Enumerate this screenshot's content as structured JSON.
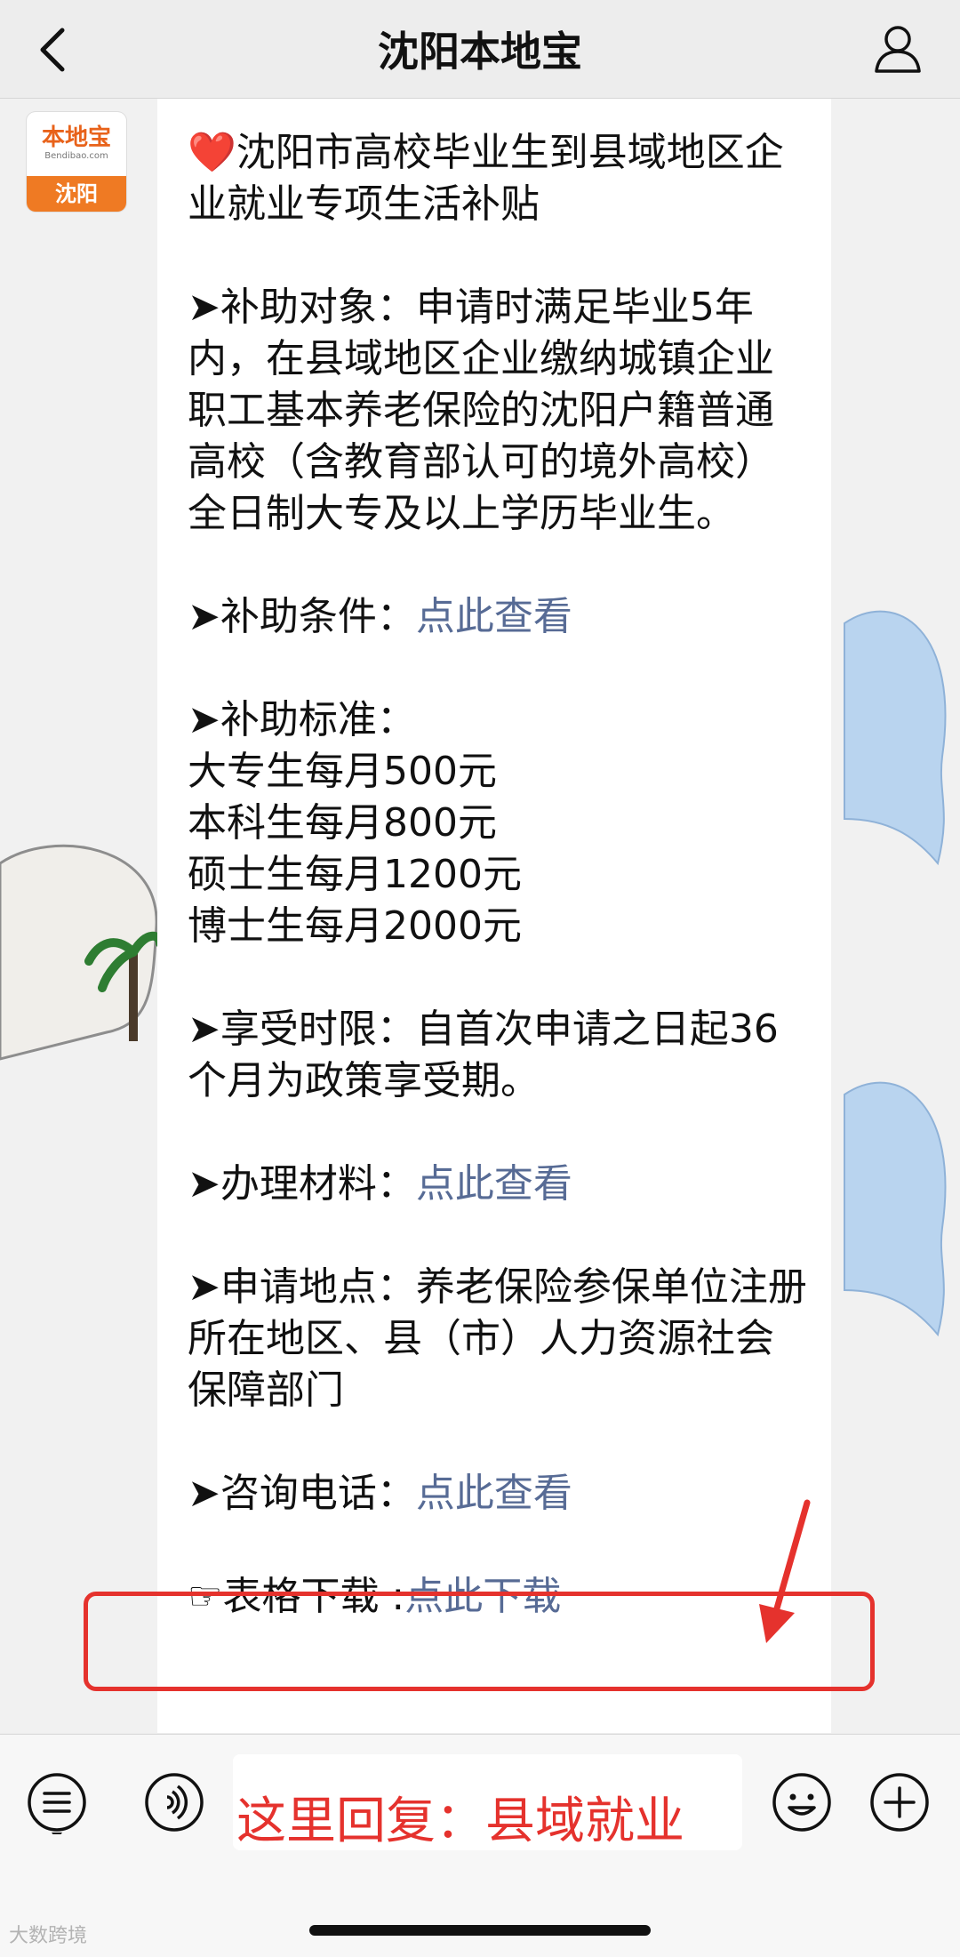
{
  "header": {
    "title": "沈阳本地宝"
  },
  "avatar": {
    "brand": "本地宝",
    "domain": "Bendibao.com",
    "city": "沈阳"
  },
  "message": {
    "heart": "❤️",
    "title": "沈阳市高校毕业生到县域地区企业就业专项生活补贴",
    "target_label": "➤补助对象：",
    "target_text": "申请时满足毕业5年内，在县域地区企业缴纳城镇企业职工基本养老保险的沈阳户籍普通高校（含教育部认可的境外高校）全日制大专及以上学历毕业生。",
    "conditions_label": "➤补助条件：",
    "conditions_link": "点此查看",
    "standard_label": "➤补助标准：",
    "standards": [
      "大专生每月500元",
      "本科生每月800元",
      "硕士生每月1200元",
      "博士生每月2000元"
    ],
    "period_label": "➤享受时限：",
    "period_text": "自首次申请之日起36个月为政策享受期。",
    "materials_label": "➤办理材料：",
    "materials_link": "点此查看",
    "location_label": "➤申请地点：",
    "location_text": "养老保险参保单位注册所在地区、县（市）人力资源社会保障部门",
    "phone_label": "➤咨询电话：",
    "phone_link": "点此查看",
    "form_label": "☞表格下载 :",
    "form_link": "点此下载"
  },
  "bottom_bar": {
    "reply_hint": "这里回复：县域就业",
    "watermark": "大数跨境"
  },
  "colors": {
    "link": "#576b95",
    "highlight_red": "#e5322d",
    "brand_orange": "#ef7a23"
  },
  "icons": [
    "back-chevron-icon",
    "profile-icon",
    "menu-list-icon",
    "voice-icon",
    "emoji-icon",
    "plus-icon"
  ]
}
